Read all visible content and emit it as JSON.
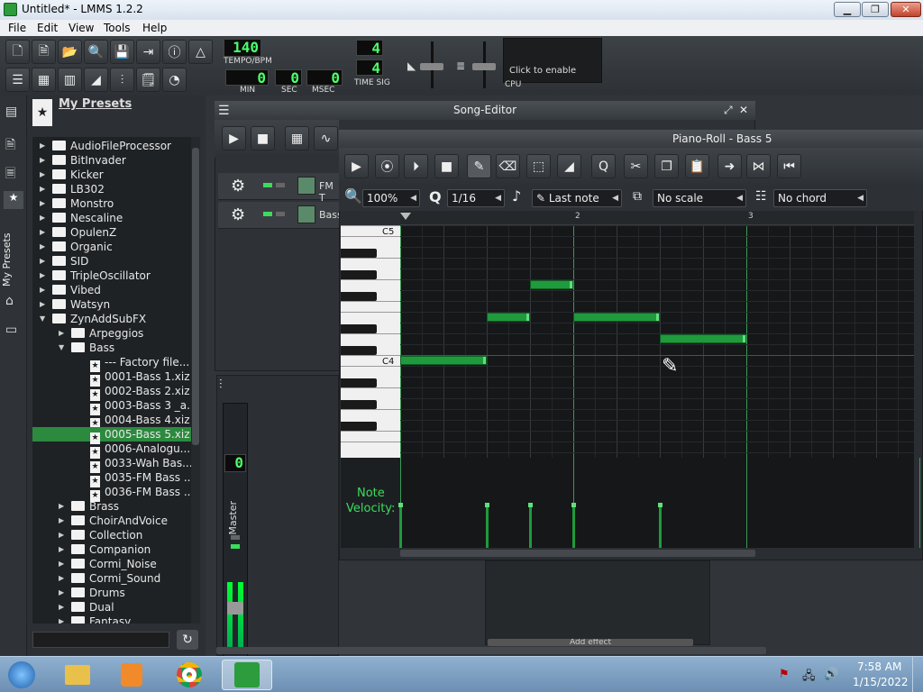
{
  "window": {
    "title": "Untitled* - LMMS 1.2.2",
    "min_icon": "minimize-icon",
    "max_icon": "maximize-icon",
    "close_icon": "close-icon"
  },
  "menu": [
    "File",
    "Edit",
    "View",
    "Tools",
    "Help"
  ],
  "transport": {
    "tempo_value": "140",
    "tempo_label": "TEMPO/BPM",
    "min_value": "0",
    "sec_value": "0",
    "msec_value": "0",
    "min_label": "MIN",
    "sec_label": "SEC",
    "msec_label": "MSEC",
    "timesig_top": "4",
    "timesig_bottom": "4",
    "timesig_label": "TIME SIG",
    "cpu_hint": "Click to enable",
    "cpu_label": "CPU"
  },
  "sidebar": {
    "title": "My Presets",
    "vertical_tab": "My Presets",
    "tree": [
      {
        "label": "AudioFileProcessor",
        "type": "folder",
        "depth": 0
      },
      {
        "label": "BitInvader",
        "type": "folder",
        "depth": 0
      },
      {
        "label": "Kicker",
        "type": "folder",
        "depth": 0
      },
      {
        "label": "LB302",
        "type": "folder",
        "depth": 0
      },
      {
        "label": "Monstro",
        "type": "folder",
        "depth": 0
      },
      {
        "label": "Nescaline",
        "type": "folder",
        "depth": 0
      },
      {
        "label": "OpulenZ",
        "type": "folder",
        "depth": 0
      },
      {
        "label": "Organic",
        "type": "folder",
        "depth": 0
      },
      {
        "label": "SID",
        "type": "folder",
        "depth": 0
      },
      {
        "label": "TripleOscillator",
        "type": "folder",
        "depth": 0
      },
      {
        "label": "Vibed",
        "type": "folder",
        "depth": 0
      },
      {
        "label": "Watsyn",
        "type": "folder",
        "depth": 0
      },
      {
        "label": "ZynAddSubFX",
        "type": "folder-open",
        "depth": 0
      },
      {
        "label": "Arpeggios",
        "type": "folder",
        "depth": 1
      },
      {
        "label": "Bass",
        "type": "folder-open",
        "depth": 1
      },
      {
        "label": "--- Factory file...",
        "type": "file",
        "depth": 2
      },
      {
        "label": "0001-Bass 1.xiz",
        "type": "file",
        "depth": 2
      },
      {
        "label": "0002-Bass 2.xiz",
        "type": "file",
        "depth": 2
      },
      {
        "label": "0003-Bass 3 _a...",
        "type": "file",
        "depth": 2
      },
      {
        "label": "0004-Bass 4.xiz",
        "type": "file",
        "depth": 2
      },
      {
        "label": "0005-Bass 5.xiz",
        "type": "file",
        "depth": 2,
        "selected": true
      },
      {
        "label": "0006-Analogu...",
        "type": "file",
        "depth": 2
      },
      {
        "label": "0033-Wah Bas...",
        "type": "file",
        "depth": 2
      },
      {
        "label": "0035-FM Bass ...",
        "type": "file",
        "depth": 2
      },
      {
        "label": "0036-FM Bass ...",
        "type": "file",
        "depth": 2
      },
      {
        "label": "Brass",
        "type": "folder",
        "depth": 1
      },
      {
        "label": "ChoirAndVoice",
        "type": "folder",
        "depth": 1
      },
      {
        "label": "Collection",
        "type": "folder",
        "depth": 1
      },
      {
        "label": "Companion",
        "type": "folder",
        "depth": 1
      },
      {
        "label": "Cormi_Noise",
        "type": "folder",
        "depth": 1
      },
      {
        "label": "Cormi_Sound",
        "type": "folder",
        "depth": 1
      },
      {
        "label": "Drums",
        "type": "folder",
        "depth": 1
      },
      {
        "label": "Dual",
        "type": "folder",
        "depth": 1
      },
      {
        "label": "Fantasy",
        "type": "folder",
        "depth": 1
      }
    ]
  },
  "song_editor": {
    "title": "Song-Editor",
    "tracks": [
      {
        "name": "FM T"
      },
      {
        "name": "Bass"
      }
    ]
  },
  "piano_roll": {
    "title": "Piano-Roll - Bass 5",
    "zoom": "100%",
    "quantize": "1/16",
    "note_length": "Last note",
    "scale": "No scale",
    "chord": "No chord",
    "key_labels": {
      "c5": "C5",
      "c4": "C4"
    },
    "ruler": [
      "2",
      "3"
    ],
    "velocity_label_1": "Note",
    "velocity_label_2": "Velocity:",
    "notes": [
      {
        "start": 0,
        "length": 4,
        "pitch": "C4"
      },
      {
        "start": 4,
        "length": 2,
        "pitch": "E4"
      },
      {
        "start": 6,
        "length": 2,
        "pitch": "G4"
      },
      {
        "start": 8,
        "length": 4,
        "pitch": "E4"
      },
      {
        "start": 12,
        "length": 4,
        "pitch": "D4"
      }
    ]
  },
  "mixer": {
    "channel_value": "0",
    "label": "Master"
  },
  "fx": {
    "add_effect": "Add effect"
  },
  "taskbar": {
    "time": "7:58 AM",
    "date": "1/15/2022"
  }
}
